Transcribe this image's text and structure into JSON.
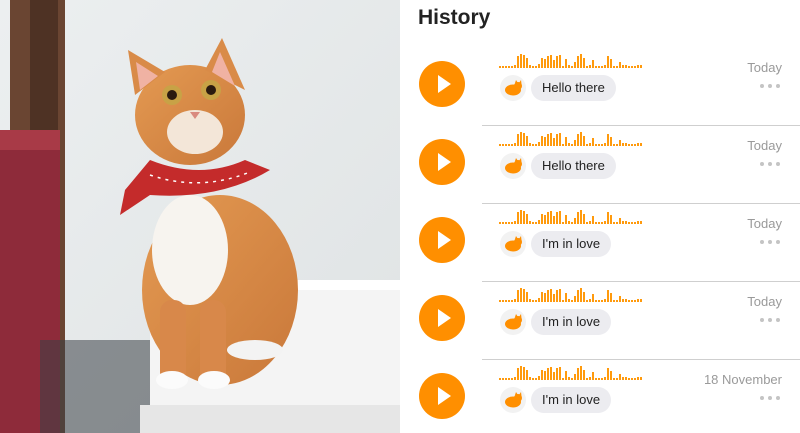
{
  "history": {
    "title": "History",
    "items": [
      {
        "date": "Today",
        "message": "Hello there"
      },
      {
        "date": "Today",
        "message": "Hello there"
      },
      {
        "date": "Today",
        "message": "I'm in love"
      },
      {
        "date": "Today",
        "message": "I'm in love"
      },
      {
        "date": "18 November",
        "message": "I'm in love"
      }
    ]
  },
  "colors": {
    "accent": "#ff8f00",
    "divider": "#cfcfcf",
    "bubble": "#ececf0"
  },
  "icons": [
    "play-icon",
    "cat-avatar-icon",
    "more-options-icon"
  ]
}
